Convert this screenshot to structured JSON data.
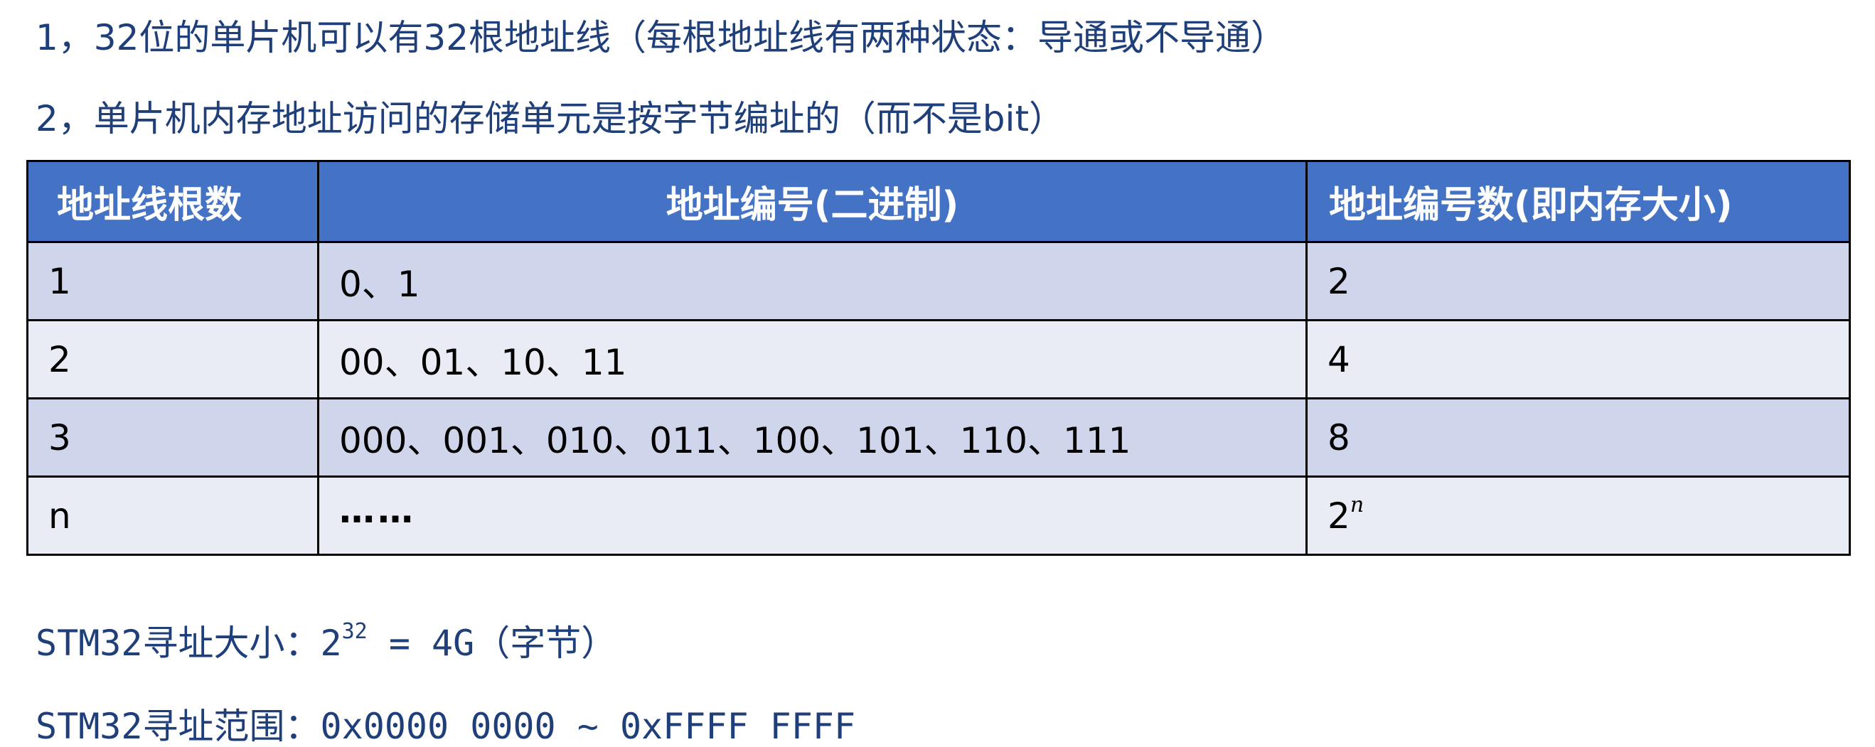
{
  "lines": {
    "line1": "1，32位的单片机可以有32根地址线（每根地址线有两种状态：导通或不导通）",
    "line2": "2，单片机内存地址访问的存储单元是按字节编址的（而不是bit）"
  },
  "table": {
    "headers": [
      "地址线根数",
      "地址编号(二进制)",
      "地址编号数(即内存大小)"
    ],
    "rows": [
      [
        "1",
        "0、1",
        "2"
      ],
      [
        "2",
        "00、01、10、11",
        "4"
      ],
      [
        "3",
        "000、001、010、011、100、101、110、111",
        "8"
      ],
      [
        "n",
        "……",
        "2",
        "n"
      ]
    ]
  },
  "footer": {
    "size_prefix": "STM32寻址大小：2",
    "size_exp": "32",
    "size_suffix": " = 4G（字节）",
    "range": "STM32寻址范围：0x0000 0000 ~ 0xFFFF FFFF"
  }
}
